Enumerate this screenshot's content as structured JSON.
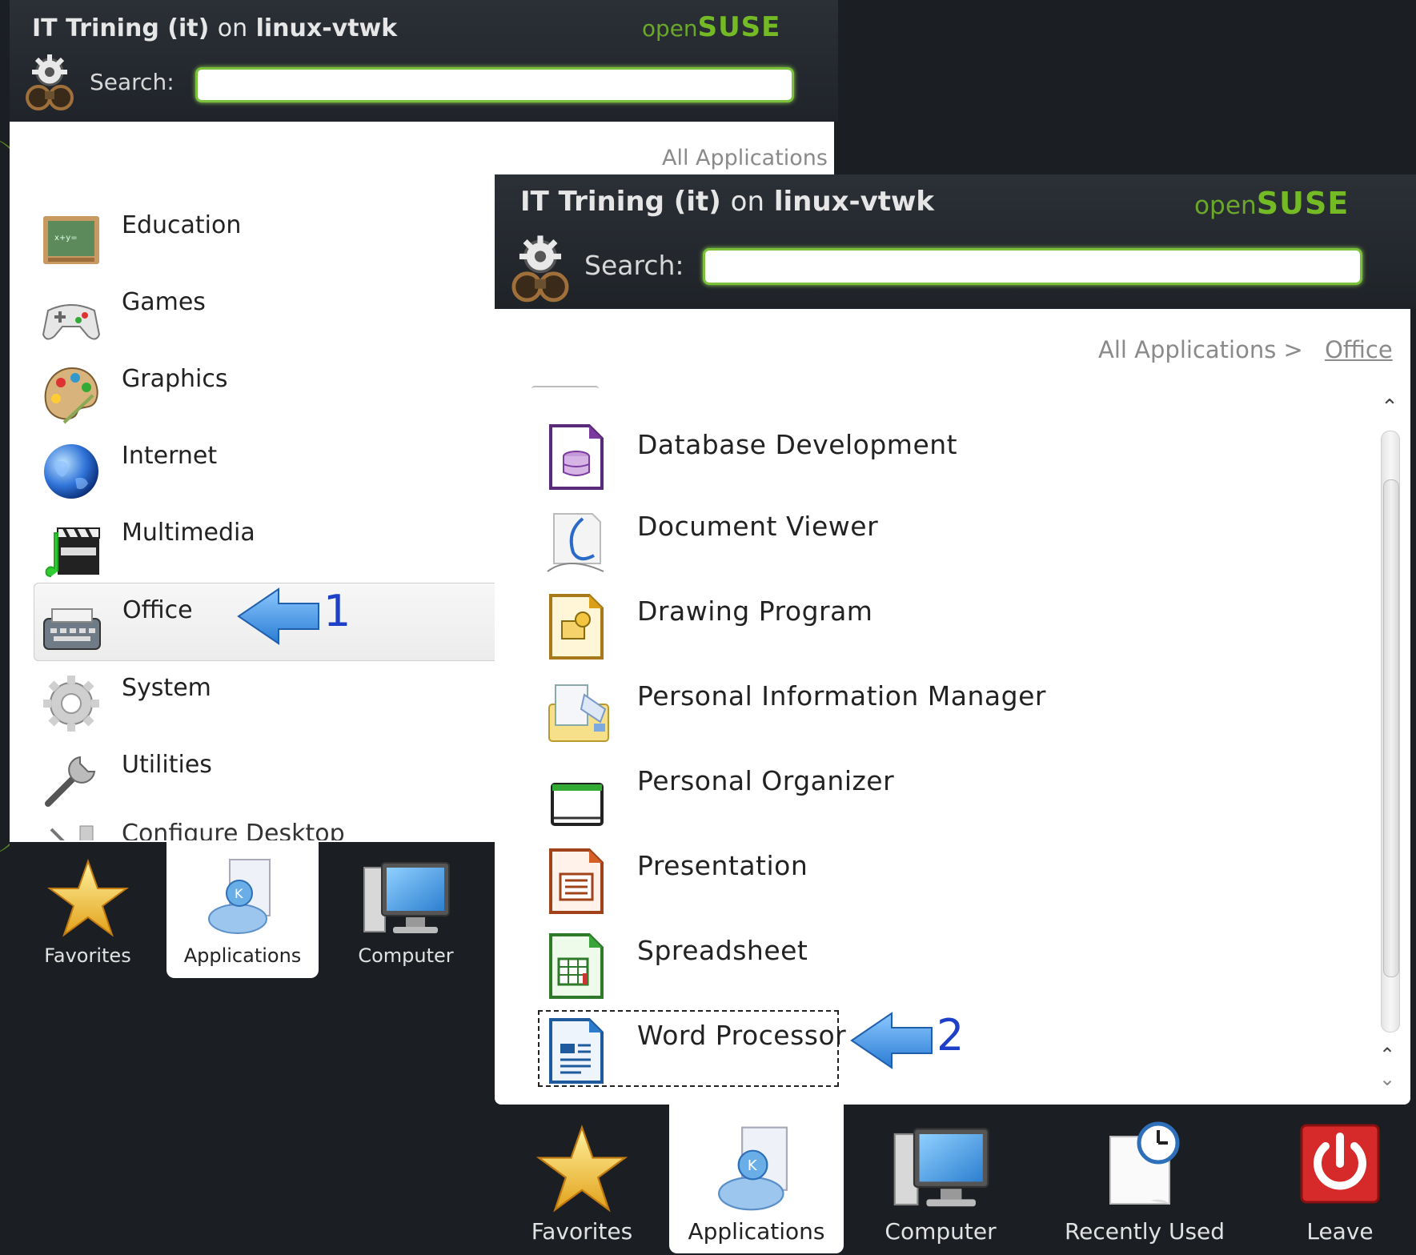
{
  "menu_back": {
    "title_user": "IT Trining (it)",
    "title_on": "on",
    "title_host": "linux-vtwk",
    "brand_open": "open",
    "brand_suse": "SUSE",
    "search_label": "Search:",
    "search_value": "",
    "breadcrumb": "All Applications",
    "categories": [
      {
        "label": "Education",
        "icon": "education-icon"
      },
      {
        "label": "Games",
        "icon": "gamepad-icon"
      },
      {
        "label": "Graphics",
        "icon": "palette-icon"
      },
      {
        "label": "Internet",
        "icon": "globe-icon"
      },
      {
        "label": "Multimedia",
        "icon": "multimedia-icon"
      },
      {
        "label": "Office",
        "icon": "typewriter-icon",
        "selected": true
      },
      {
        "label": "System",
        "icon": "system-gear-icon"
      },
      {
        "label": "Utilities",
        "icon": "wrench-icon"
      }
    ],
    "cutoff_item": "Configure Desktop",
    "tabs": [
      {
        "label": "Favorites",
        "icon": "star-icon"
      },
      {
        "label": "Applications",
        "icon": "applications-icon",
        "active": true
      },
      {
        "label": "Computer",
        "icon": "computer-icon"
      }
    ]
  },
  "menu_front": {
    "title_user": "IT Trining (it)",
    "title_on": "on",
    "title_host": "linux-vtwk",
    "brand_open": "open",
    "brand_suse": "SUSE",
    "search_label": "Search:",
    "search_value": "",
    "breadcrumb_root": "All Applications >",
    "breadcrumb_current": "Office",
    "apps": [
      {
        "label": "Database Development",
        "icon": "database-icon"
      },
      {
        "label": "Document Viewer",
        "icon": "document-viewer-icon"
      },
      {
        "label": "Drawing Program",
        "icon": "drawing-icon"
      },
      {
        "label": "Personal Information Manager",
        "icon": "pim-icon"
      },
      {
        "label": "Personal Organizer",
        "icon": "calendar-icon"
      },
      {
        "label": "Presentation",
        "icon": "presentation-icon"
      },
      {
        "label": "Spreadsheet",
        "icon": "spreadsheet-icon"
      },
      {
        "label": "Word Processor",
        "icon": "word-processor-icon",
        "focused": true
      }
    ],
    "tabs": [
      {
        "label": "Favorites",
        "icon": "star-icon"
      },
      {
        "label": "Applications",
        "icon": "applications-icon",
        "active": true
      },
      {
        "label": "Computer",
        "icon": "computer-icon"
      },
      {
        "label": "Recently Used",
        "icon": "recently-used-icon"
      },
      {
        "label": "Leave",
        "icon": "power-icon"
      }
    ]
  },
  "annotations": {
    "step1": "1",
    "step2": "2"
  },
  "colors": {
    "accent_green": "#73ba25",
    "panel_dark": "#1b1e22",
    "annotation_blue": "#1e3fc8",
    "arrow_blue": "#3a8fd9"
  }
}
